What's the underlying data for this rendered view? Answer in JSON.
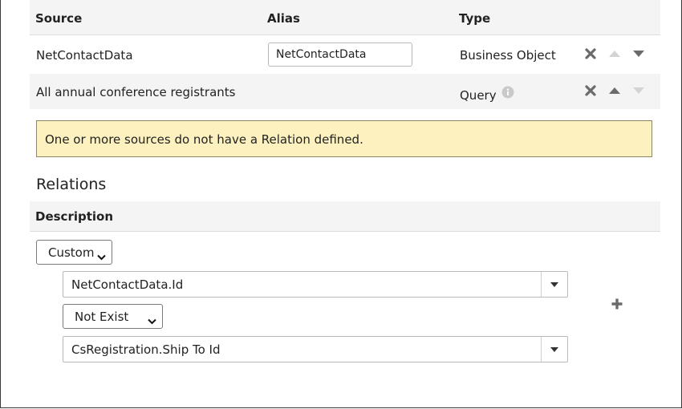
{
  "sources": {
    "headers": {
      "source": "Source",
      "alias": "Alias",
      "type": "Type"
    },
    "rows": [
      {
        "source": "NetContactData",
        "alias": "NetContactData",
        "type": "Business Object",
        "has_alias_input": true,
        "up_enabled": false,
        "down_enabled": true
      },
      {
        "source": "All annual conference registrants",
        "alias": "",
        "type": "Query",
        "has_info_icon": true,
        "up_enabled": true,
        "down_enabled": false
      }
    ]
  },
  "warning": {
    "message": "One or more sources do not have a Relation defined."
  },
  "relations": {
    "title": "Relations",
    "header_description": "Description",
    "relation_type": "Custom",
    "left_field": "NetContactData.Id",
    "operator": "Not Exist",
    "right_field": "CsRegistration.Ship To Id"
  },
  "icons": {
    "remove": "remove-x-icon",
    "move_up": "move-up-icon",
    "move_down": "move-down-icon",
    "info": "info-icon",
    "add": "plus-icon",
    "dropdown": "dropdown-caret-icon"
  },
  "colors": {
    "warning_bg": "#fcf1bf",
    "header_bg": "#f4f4f4",
    "icon_active": "#6b6b6b",
    "icon_disabled": "#d4d4d4"
  }
}
